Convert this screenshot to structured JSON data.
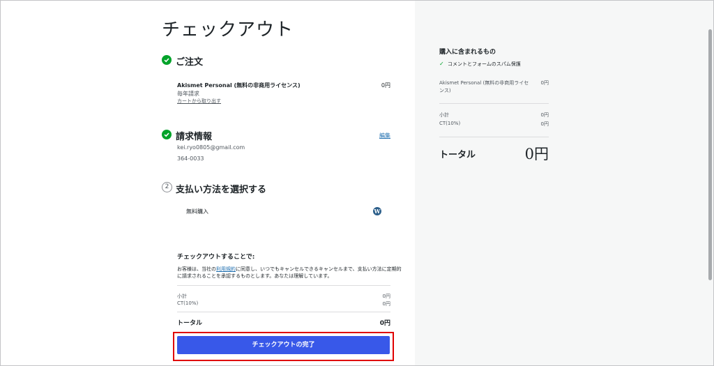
{
  "page": {
    "title": "チェックアウト"
  },
  "order": {
    "heading": "ご注文",
    "product_name": "Akismet Personal (無料の非商用ライセンス)",
    "product_price": "0円",
    "billing_cycle": "毎年請求",
    "remove_link": "カートから取り出す"
  },
  "billing": {
    "heading": "請求情報",
    "edit_link": "編集",
    "email": "kei.ryo0805@gmail.com",
    "postal_code": "364-0033"
  },
  "payment": {
    "step_number": "2",
    "heading": "支払い方法を選択する",
    "method_label": "無料購入"
  },
  "terms": {
    "heading": "チェックアウトすることで:",
    "text_before_link": "お客様は、当社の",
    "link_text": "利用規約",
    "text_after_link": "に同意し、いつでもキャンセルできるキャンセルまで、支払い方法に定期的",
    "text_line2": "に請求されることを承認するものとします。あなたは理解しています。"
  },
  "summary": {
    "subtotal_label": "小計",
    "subtotal_value": "0円",
    "tax_label": "CT(10%)",
    "tax_value": "0円",
    "total_label": "トータル",
    "total_value": "0円"
  },
  "checkout_button": {
    "label": "チェックアウトの完了"
  },
  "sidebar": {
    "heading": "購入に含まれるもの",
    "feature": "コメントとフォームのスパム保護",
    "product_line1": "Akismet Personal (無料の非商用ライセ",
    "product_line2": "ンス)",
    "product_price": "0円",
    "subtotal_label": "小計",
    "subtotal_value": "0円",
    "tax_label": "CT(10%)",
    "tax_value": "0円",
    "total_label": "トータル",
    "total_value": "0円"
  },
  "colors": {
    "accent": "#3858e9",
    "success": "#00a32a",
    "highlight": "#e00000",
    "link": "#2271b1"
  }
}
